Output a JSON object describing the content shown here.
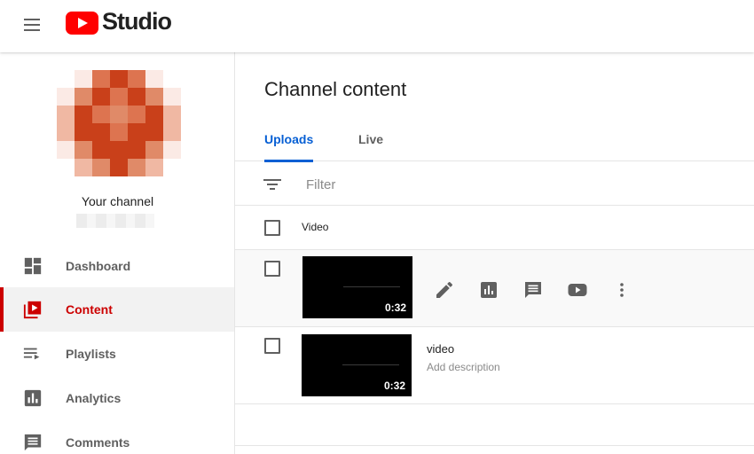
{
  "header": {
    "logo_text": "Studio",
    "icons": {
      "menu": "hamburger-menu-icon",
      "logo": "youtube-logo"
    },
    "colors": {
      "brand_red": "#ff0000"
    }
  },
  "sidebar": {
    "channel_label": "Your channel",
    "items": [
      {
        "label": "Dashboard",
        "icon": "dashboard-icon",
        "active": false
      },
      {
        "label": "Content",
        "icon": "content-icon",
        "active": true
      },
      {
        "label": "Playlists",
        "icon": "playlists-icon",
        "active": false
      },
      {
        "label": "Analytics",
        "icon": "analytics-icon",
        "active": false
      },
      {
        "label": "Comments",
        "icon": "comments-icon",
        "active": false
      }
    ],
    "colors": {
      "active_accent": "#cc0000",
      "active_bg": "#f2f2f2"
    }
  },
  "main": {
    "title": "Channel content",
    "tabs": [
      {
        "label": "Uploads",
        "active": true
      },
      {
        "label": "Live",
        "active": false
      }
    ],
    "filter": {
      "placeholder": "Filter"
    },
    "table": {
      "column_video": "Video",
      "rows": [
        {
          "duration": "0:32",
          "title": "",
          "description": "",
          "actions": [
            "edit-icon",
            "analytics-icon",
            "comments-icon",
            "youtube-play-icon",
            "more-vert-icon"
          ]
        },
        {
          "duration": "0:32",
          "title": "video",
          "description": "Add description"
        }
      ]
    },
    "colors": {
      "tab_accent": "#065fd4"
    }
  }
}
